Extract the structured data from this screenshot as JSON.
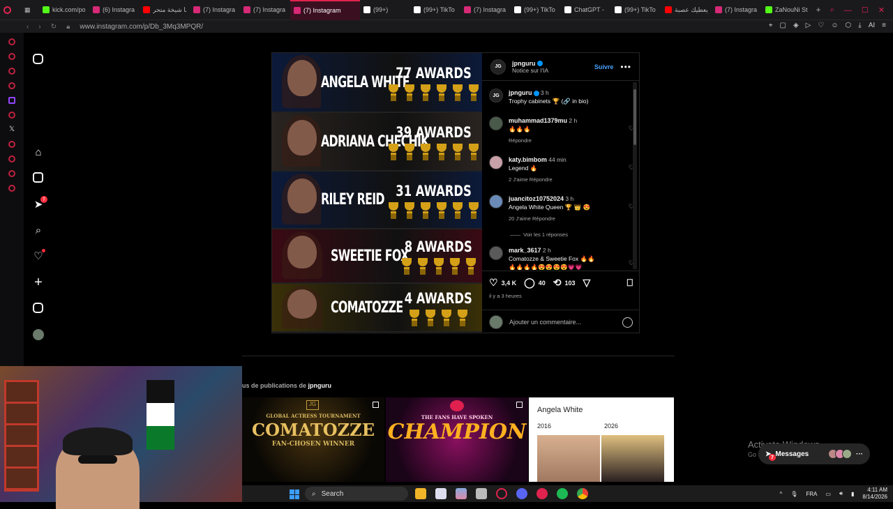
{
  "browser": {
    "tabs": [
      {
        "label": "kick.com/po",
        "color": "#53fc18"
      },
      {
        "label": "(6) Instagra",
        "color": "#d62976"
      },
      {
        "label": "انا شيخة متحر",
        "color": "#ff0000"
      },
      {
        "label": "(7) Instagra",
        "color": "#d62976"
      },
      {
        "label": "(7) Instagra",
        "color": "#d62976"
      },
      {
        "label": "(7) Instagram",
        "color": "#d62976",
        "active": true
      },
      {
        "label": "(99+)",
        "color": "#ffffff"
      },
      {
        "label": "(99+) TikTo",
        "color": "#ffffff"
      },
      {
        "label": "(7) Instagra",
        "color": "#d62976"
      },
      {
        "label": "(99+) TikTo",
        "color": "#ffffff"
      },
      {
        "label": "ChatGPT - ",
        "color": "#ffffff"
      },
      {
        "label": "(99+) TikTo",
        "color": "#ffffff"
      },
      {
        "label": "يعطيك عصبة",
        "color": "#ff0000"
      },
      {
        "label": "(7) Instagra",
        "color": "#d62976"
      },
      {
        "label": "ZaNouNi St",
        "color": "#53fc18"
      }
    ],
    "url": "www.instagram.com/p/Db_3Mq3MPQR/",
    "ai_label": "AI"
  },
  "ig_nav": {
    "messages_badge": "7"
  },
  "post": {
    "image_rows": [
      {
        "name": "ANGELA WHITE",
        "awards": "77 AWARDS",
        "trophies": 6,
        "bg": "#0c1a3a"
      },
      {
        "name": "ADRIANA CHECHIK",
        "awards": "39 AWARDS",
        "trophies": 6,
        "bg": "#2a2420"
      },
      {
        "name": "RILEY REID",
        "awards": "31 AWARDS",
        "trophies": 6,
        "bg": "#0c1a3a"
      },
      {
        "name": "SWEETIE FOX",
        "awards": "8 AWARDS",
        "trophies": 5,
        "bg": "#3a0a14"
      },
      {
        "name": "COMATOZZE",
        "awards": "4 AWARDS",
        "trophies": 4,
        "bg": "#3a3008"
      }
    ],
    "author": "jpnguru",
    "author_sub": "Notice sur l'IA",
    "follow_label": "Suivre",
    "caption_user": "jpnguru",
    "caption_time": "3 h",
    "caption_text": "Trophy cabinets 🏆 (🔗 in bio)",
    "comments": [
      {
        "user": "muhammad1379mu",
        "time": "2 h",
        "text": "🔥🔥🔥",
        "meta": "Répondre"
      },
      {
        "user": "katy.bimbom",
        "time": "44 min",
        "text": "Legend 🔥",
        "meta": "2 J'aime   Répondre"
      },
      {
        "user": "juancitoz10752024",
        "time": "3 h",
        "text": "Angela White Queen 🏆 👑 😍",
        "meta": "20 J'aime   Répondre"
      },
      {
        "user": "mark_3617",
        "time": "2 h",
        "text": "Comatozze & Sweetie Fox 🔥🔥",
        "text2": "🔥🔥🔥🔥😍😍😍😍💗💗",
        "meta": ""
      }
    ],
    "view_replies": "Voir les 1 réponses",
    "likes": "3,4 K",
    "comment_count": "40",
    "shares": "103",
    "posted": "il y a 3 heures",
    "add_comment_placeholder": "Ajouter un commentaire..."
  },
  "more": {
    "prefix": "us de publications de",
    "user": "jpnguru",
    "thumbs": [
      {
        "line1": "GLOBAL ACTRESS TOURNAMENT",
        "line2": "COMATOZZE",
        "line3": "FAN-CHOSEN WINNER"
      },
      {
        "line1": "THE FANS HAVE SPOKEN",
        "line2": "CHAMPION"
      },
      {
        "title": "Angela White",
        "year1": "2016",
        "year2": "2026"
      }
    ]
  },
  "overlay": {
    "activate_title": "Activate Windows",
    "activate_sub": "Go to",
    "messages_label": "Messages",
    "messages_badge": "7"
  },
  "taskbar": {
    "search_label": "Search",
    "lang": "FRA",
    "time": "4:11 AM",
    "date": "8/14/2026"
  }
}
